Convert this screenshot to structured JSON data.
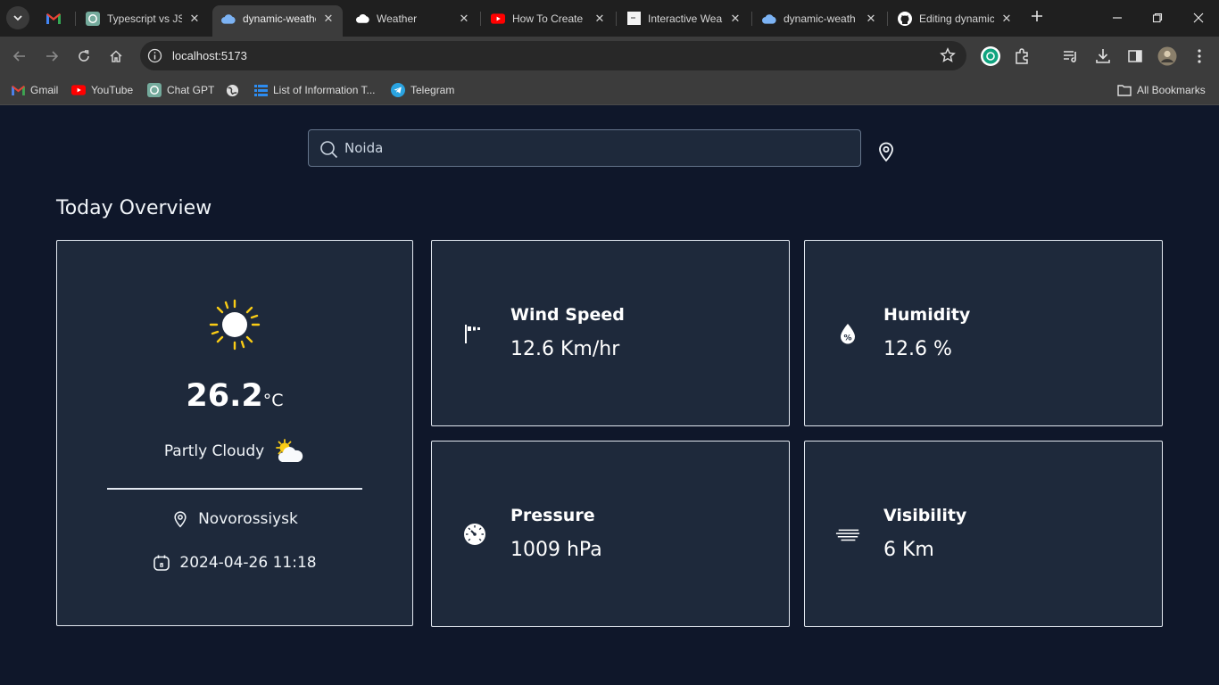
{
  "browser": {
    "tabs": [
      {
        "label": "",
        "icon": "gmail-icon",
        "active": false
      },
      {
        "label": "Typescript vs JS",
        "icon": "chatgpt-icon",
        "active": false
      },
      {
        "label": "dynamic-weather",
        "icon": "cloud-icon",
        "active": true
      },
      {
        "label": "Weather",
        "icon": "cloud-icon",
        "active": false
      },
      {
        "label": "How To Create",
        "icon": "youtube-icon",
        "active": false
      },
      {
        "label": "Interactive Wea",
        "icon": "page-icon",
        "active": false
      },
      {
        "label": "dynamic-weath",
        "icon": "cloud-icon",
        "active": false
      },
      {
        "label": "Editing dynamic",
        "icon": "github-icon",
        "active": false
      }
    ],
    "address": "localhost:5173",
    "bookmarks": [
      {
        "label": "Gmail",
        "icon": "gmail-icon"
      },
      {
        "label": "YouTube",
        "icon": "youtube-icon"
      },
      {
        "label": "Chat GPT",
        "icon": "chatgpt-icon"
      },
      {
        "label": "",
        "icon": "globe-icon"
      },
      {
        "label": "List of Information T...",
        "icon": "list-icon"
      },
      {
        "label": "Telegram",
        "icon": "telegram-icon"
      }
    ],
    "all_bookmarks_label": "All Bookmarks",
    "close_glyph": "✕"
  },
  "search": {
    "placeholder": "Noida",
    "value": ""
  },
  "overview": {
    "title": "Today Overview"
  },
  "current": {
    "temperature": "26.2",
    "unit": "°C",
    "condition": "Partly Cloudy",
    "location": "Novorossiysk",
    "datetime": "2024-04-26 11:18",
    "calendar_day": "8"
  },
  "stats": [
    {
      "label": "Wind Speed",
      "value": "12.6 Km/hr",
      "icon": "windsock-icon"
    },
    {
      "label": "Humidity",
      "value": "12.6 %",
      "icon": "humidity-drop-icon",
      "icon_text": "%"
    },
    {
      "label": "Pressure",
      "value": "1009 hPa",
      "icon": "pressure-gauge-icon"
    },
    {
      "label": "Visibility",
      "value": "6 Km",
      "icon": "visibility-lines-icon"
    }
  ],
  "colors": {
    "page_bg": "#0f172a",
    "card_bg": "#1e293b",
    "card_border": "#e2e8f0",
    "sun_yellow": "#facc15",
    "text": "#ffffff"
  }
}
